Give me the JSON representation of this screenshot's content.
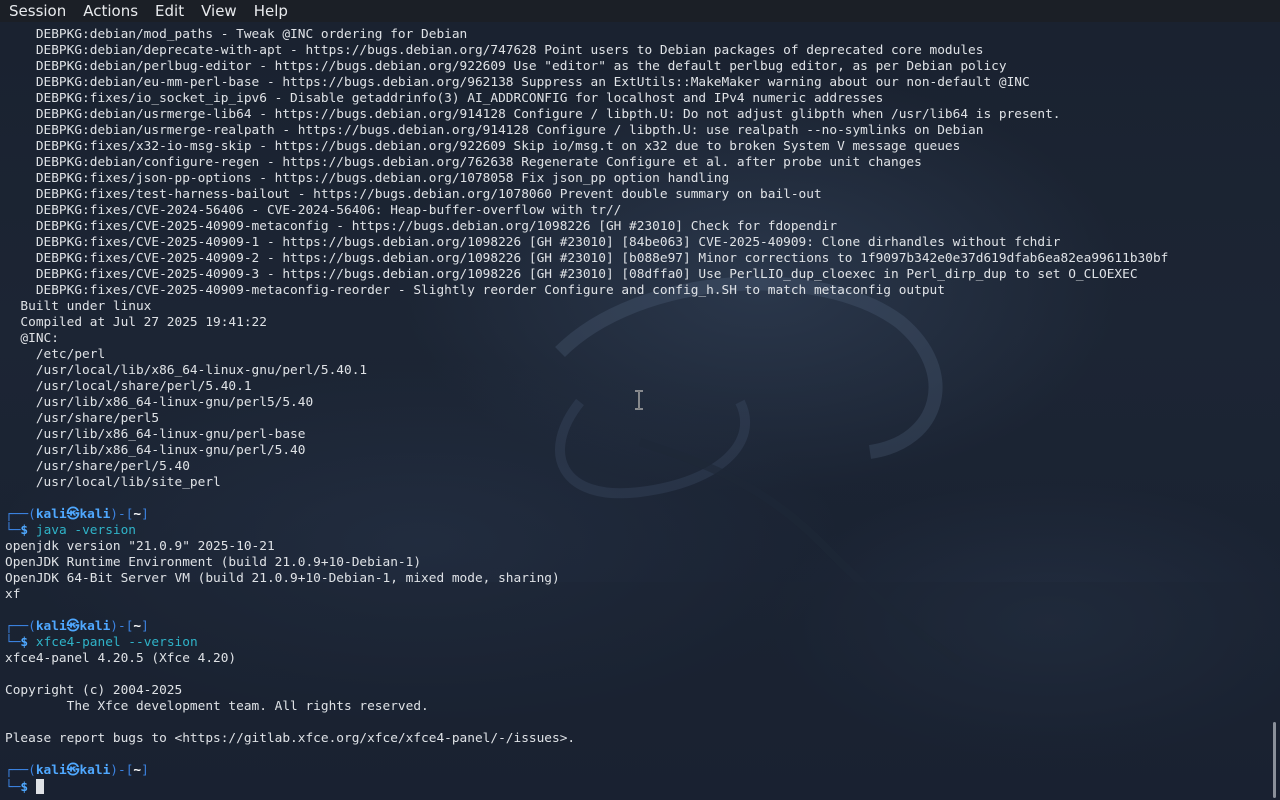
{
  "menubar": {
    "items": [
      "Session",
      "Actions",
      "Edit",
      "View",
      "Help"
    ]
  },
  "terminal": {
    "output_lines": [
      "    DEBPKG:debian/mod_paths - Tweak @INC ordering for Debian",
      "    DEBPKG:debian/deprecate-with-apt - https://bugs.debian.org/747628 Point users to Debian packages of deprecated core modules",
      "    DEBPKG:debian/perlbug-editor - https://bugs.debian.org/922609 Use \"editor\" as the default perlbug editor, as per Debian policy",
      "    DEBPKG:debian/eu-mm-perl-base - https://bugs.debian.org/962138 Suppress an ExtUtils::MakeMaker warning about our non-default @INC",
      "    DEBPKG:fixes/io_socket_ip_ipv6 - Disable getaddrinfo(3) AI_ADDRCONFIG for localhost and IPv4 numeric addresses",
      "    DEBPKG:debian/usrmerge-lib64 - https://bugs.debian.org/914128 Configure / libpth.U: Do not adjust glibpth when /usr/lib64 is present.",
      "    DEBPKG:debian/usrmerge-realpath - https://bugs.debian.org/914128 Configure / libpth.U: use realpath --no-symlinks on Debian",
      "    DEBPKG:fixes/x32-io-msg-skip - https://bugs.debian.org/922609 Skip io/msg.t on x32 due to broken System V message queues",
      "    DEBPKG:debian/configure-regen - https://bugs.debian.org/762638 Regenerate Configure et al. after probe unit changes",
      "    DEBPKG:fixes/json-pp-options - https://bugs.debian.org/1078058 Fix json_pp option handling",
      "    DEBPKG:fixes/test-harness-bailout - https://bugs.debian.org/1078060 Prevent double summary on bail-out",
      "    DEBPKG:fixes/CVE-2024-56406 - CVE-2024-56406: Heap-buffer-overflow with tr//",
      "    DEBPKG:fixes/CVE-2025-40909-metaconfig - https://bugs.debian.org/1098226 [GH #23010] Check for fdopendir",
      "    DEBPKG:fixes/CVE-2025-40909-1 - https://bugs.debian.org/1098226 [GH #23010] [84be063] CVE-2025-40909: Clone dirhandles without fchdir",
      "    DEBPKG:fixes/CVE-2025-40909-2 - https://bugs.debian.org/1098226 [GH #23010] [b088e97] Minor corrections to 1f9097b342e0e37d619dfab6ea82ea99611b30bf",
      "    DEBPKG:fixes/CVE-2025-40909-3 - https://bugs.debian.org/1098226 [GH #23010] [08dffa0] Use PerlLIO_dup_cloexec in Perl_dirp_dup to set O_CLOEXEC",
      "    DEBPKG:fixes/CVE-2025-40909-metaconfig-reorder - Slightly reorder Configure and config_h.SH to match metaconfig output",
      "  Built under linux",
      "  Compiled at Jul 27 2025 19:41:22",
      "  @INC:",
      "    /etc/perl",
      "    /usr/local/lib/x86_64-linux-gnu/perl/5.40.1",
      "    /usr/local/share/perl/5.40.1",
      "    /usr/lib/x86_64-linux-gnu/perl5/5.40",
      "    /usr/share/perl5",
      "    /usr/lib/x86_64-linux-gnu/perl-base",
      "    /usr/lib/x86_64-linux-gnu/perl/5.40",
      "    /usr/share/perl/5.40",
      "    /usr/local/lib/site_perl",
      ""
    ],
    "prompt": {
      "top_prefix": "┌──(",
      "user": "kali",
      "at": "㉿",
      "host": "kali",
      "mid": ")-[",
      "dir": "~",
      "end": "]",
      "bottom_prefix": "└─",
      "dollar": "$"
    },
    "session1": {
      "command": "java -version",
      "output": [
        "openjdk version \"21.0.9\" 2025-10-21",
        "OpenJDK Runtime Environment (build 21.0.9+10-Debian-1)",
        "OpenJDK 64-Bit Server VM (build 21.0.9+10-Debian-1, mixed mode, sharing)",
        "xf",
        ""
      ]
    },
    "session2": {
      "command": "xfce4-panel --version",
      "output": [
        "xfce4-panel 4.20.5 (Xfce 4.20)",
        "",
        "Copyright (c) 2004-2025",
        "        The Xfce development team. All rights reserved.",
        "",
        "Please report bugs to <https://gitlab.xfce.org/xfce/xfce4-panel/-/issues>.",
        ""
      ]
    }
  },
  "colors": {
    "background": "#151c27",
    "menubar": "#1b1f26",
    "text": "#dfe2e6",
    "prompt_blue": "#3b82e0",
    "command_cyan": "#2fb3c8"
  }
}
